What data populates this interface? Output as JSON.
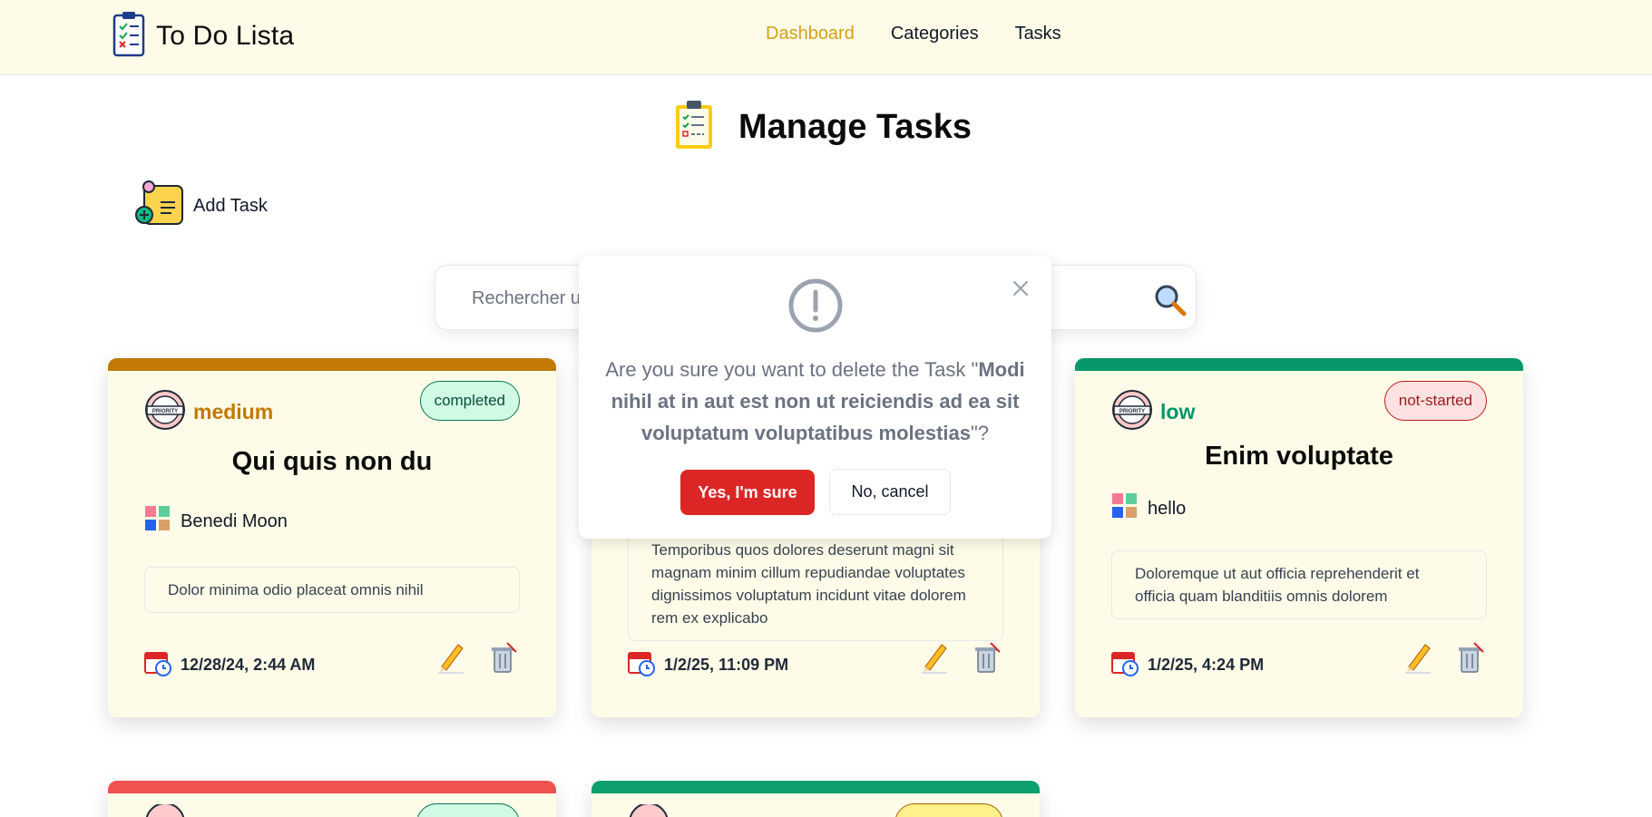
{
  "app": {
    "title": "To Do Lista"
  },
  "nav": {
    "items": [
      {
        "label": "Dashboard",
        "active": true
      },
      {
        "label": "Categories",
        "active": false
      },
      {
        "label": "Tasks",
        "active": false
      }
    ]
  },
  "page": {
    "title": "Manage Tasks",
    "add_task_label": "Add Task"
  },
  "search": {
    "placeholder": "Rechercher une tâche"
  },
  "cards": [
    {
      "priority": "medium",
      "priority_color": "#c27803",
      "status": "completed",
      "title": "Qui quis non du",
      "category": "Benedi Moon",
      "description": "Dolor minima odio placeat omnis nihil",
      "date": "12/28/24, 2:44 AM"
    },
    {
      "description": "Temporibus quos dolores deserunt magni sit magnam minim cillum repudiandae voluptates dignissimos voluptatum incidunt vitae dolorem rem ex explicabo",
      "date": "1/2/25, 11:09 PM"
    },
    {
      "priority": "low",
      "priority_color": "#059669",
      "status": "not-started",
      "title": "Enim voluptate",
      "category": "hello",
      "description": "Doloremque ut aut officia reprehenderit et officia quam blanditiis omnis dolorem",
      "date": "1/2/25, 4:24 PM"
    }
  ],
  "bottom_cards": [
    {
      "bar_color": "#f05252"
    },
    {
      "bar_color": "#0e9f6e"
    }
  ],
  "modal": {
    "message_prefix": "Are you sure you want to delete the Task \"",
    "task_name": "Modi nihil at in aut est non ut reiciendis ad ea sit voluptatum voluptatibus molestias",
    "message_suffix": "\"?",
    "confirm_label": "Yes, I'm sure",
    "cancel_label": "No, cancel"
  },
  "icons": {
    "logo": "clipboard-checklist-icon",
    "header": "clipboard-checklist-icon",
    "add": "sticky-note-add-icon",
    "search": "magnifier-icon",
    "priority": "priority-badge-icon",
    "category": "category-grid-icon",
    "date": "calendar-clock-icon",
    "edit": "pencil-icon",
    "delete": "trash-icon",
    "close": "close-icon",
    "warning": "exclamation-circle-icon"
  },
  "colors": {
    "accent": "#d4a017",
    "danger": "#dc2626",
    "card_bg": "#fefce8"
  }
}
